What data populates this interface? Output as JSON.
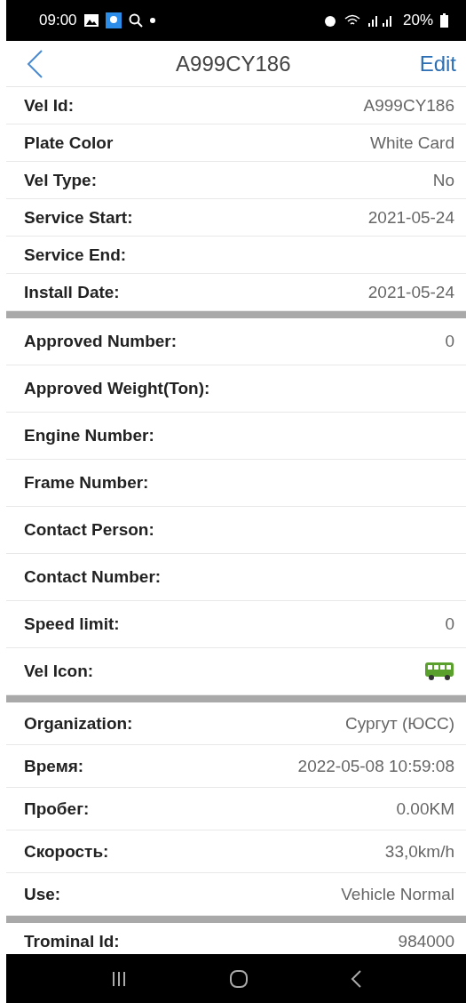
{
  "status_bar": {
    "time": "09:00",
    "battery": "20%"
  },
  "header": {
    "title": "A999CY186",
    "action": "Edit"
  },
  "sections": [
    {
      "rows": [
        {
          "kind": "text",
          "label": "Vel Id:",
          "value": "A999CY186"
        },
        {
          "kind": "text",
          "label": "Plate Color",
          "value": "White Card"
        },
        {
          "kind": "text",
          "label": "Vel Type:",
          "value": "No"
        },
        {
          "kind": "text",
          "label": "Service Start:",
          "value": "2021-05-24"
        },
        {
          "kind": "text",
          "label": "Service End:"
        },
        {
          "kind": "text",
          "label": "Install Date:",
          "value": "2021-05-24"
        }
      ]
    },
    {
      "rows": [
        {
          "kind": "text",
          "label": "Approved Number:",
          "value": "0"
        },
        {
          "kind": "text",
          "label": "Approved Weight(Ton):"
        },
        {
          "kind": "text",
          "label": "Engine Number:"
        },
        {
          "kind": "text",
          "label": "Frame Number:"
        },
        {
          "kind": "text",
          "label": "Contact Person:"
        },
        {
          "kind": "text",
          "label": "Contact Number:"
        },
        {
          "kind": "text",
          "label": "Speed limit:",
          "value": "0"
        },
        {
          "kind": "icon",
          "label": "Vel Icon:"
        }
      ]
    },
    {
      "rows": [
        {
          "kind": "text",
          "label": "Organization:",
          "value": "Сургут (ЮСС)"
        },
        {
          "kind": "text",
          "label": "Время:",
          "value": "2022-05-08 10:59:08"
        },
        {
          "kind": "text",
          "label": "Пробег:",
          "value": "0.00KM"
        },
        {
          "kind": "text",
          "label": "Скорость:",
          "value": "33,0km/h"
        },
        {
          "kind": "text",
          "label": "Use:",
          "value": "Vehicle Normal"
        }
      ]
    },
    {
      "rows": [
        {
          "kind": "text",
          "label": "Trominal Id:",
          "value": "984000"
        }
      ]
    }
  ]
}
